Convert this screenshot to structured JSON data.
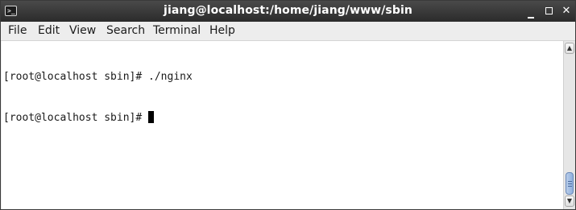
{
  "window": {
    "title": "jiang@localhost:/home/jiang/www/sbin",
    "icon_glyph": ">_",
    "icon": "terminal-icon",
    "controls": {
      "minimize_icon": "minimize-icon",
      "maximize_icon": "maximize-icon",
      "close_glyph": "✕"
    }
  },
  "menu": {
    "items": [
      "File",
      "Edit",
      "View",
      "Search",
      "Terminal",
      "Help"
    ]
  },
  "terminal": {
    "lines": [
      "[root@localhost sbin]# ./nginx",
      "[root@localhost sbin]# "
    ]
  },
  "scrollbar": {
    "up_glyph": "▲",
    "down_glyph": "▼"
  },
  "colors": {
    "titlebar": "#2b2b2b",
    "terminal_bg": "#ffffff",
    "terminal_fg": "#1a1a1a",
    "scroll_thumb": "#8fb0de"
  }
}
